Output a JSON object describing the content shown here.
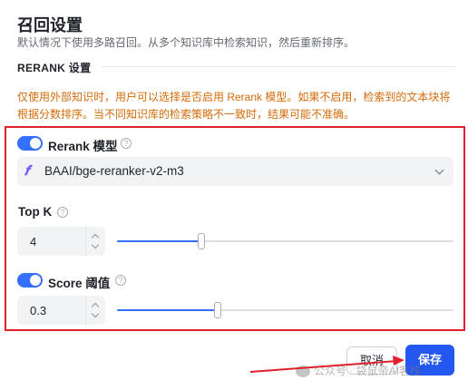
{
  "header": {
    "title": "召回设置",
    "subtitle": "默认情况下使用多路召回。从多个知识库中检索知识，然后重新排序。"
  },
  "section": {
    "heading": "RERANK 设置"
  },
  "warning": "仅使用外部知识时，用户可以选择是否启用 Rerank 模型。如果不启用，检索到的文本块将根据分数排序。当不同知识库的检索策略不一致时，结果可能不准确。",
  "rerank": {
    "enabled": true,
    "label": "Rerank 模型",
    "help": "?",
    "model": "BAAI/bge-reranker-v2-m3",
    "model_icon": "𝒇"
  },
  "top_k": {
    "label": "Top K",
    "help": "?",
    "value": "4",
    "slider_fraction": 0.25
  },
  "score": {
    "enabled": true,
    "label": "Score 阈值",
    "help": "?",
    "value": "0.3",
    "slider_fraction": 0.3
  },
  "footer": {
    "cancel_label": "取消",
    "save_label": "保存"
  },
  "watermark": "公众号 · 袋鼠帝AI客栈",
  "colors": {
    "accent": "#3370ff",
    "save_button": "#2456f0",
    "warning_text": "#d46b08",
    "highlight_box": "#e0202a"
  }
}
